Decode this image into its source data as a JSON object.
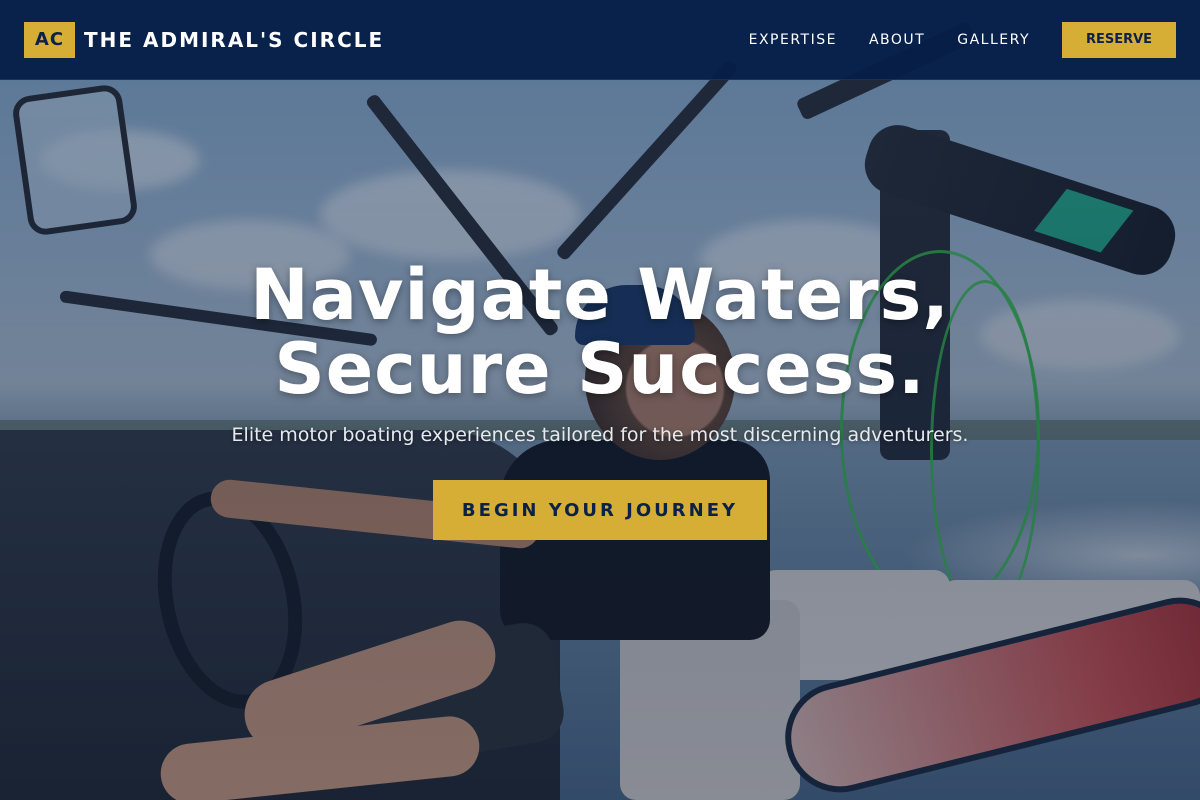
{
  "brand": {
    "logo_text": "AC",
    "name": "THE ADMIRAL'S CIRCLE"
  },
  "nav": {
    "links": [
      "EXPERTISE",
      "ABOUT",
      "GALLERY"
    ],
    "reserve_label": "RESERVE"
  },
  "hero": {
    "headline_line1": "Navigate Waters,",
    "headline_line2": "Secure Success.",
    "subtitle": "Elite motor boating experiences tailored for the most discerning adventurers.",
    "cta_label": "BEGIN YOUR JOURNEY",
    "background_description": "man-driving-motorboat-photo"
  },
  "colors": {
    "navbar_bg": "#061e48",
    "accent_gold": "#d6ae35",
    "text_dark": "#0b2148",
    "text_light": "#ffffff"
  }
}
